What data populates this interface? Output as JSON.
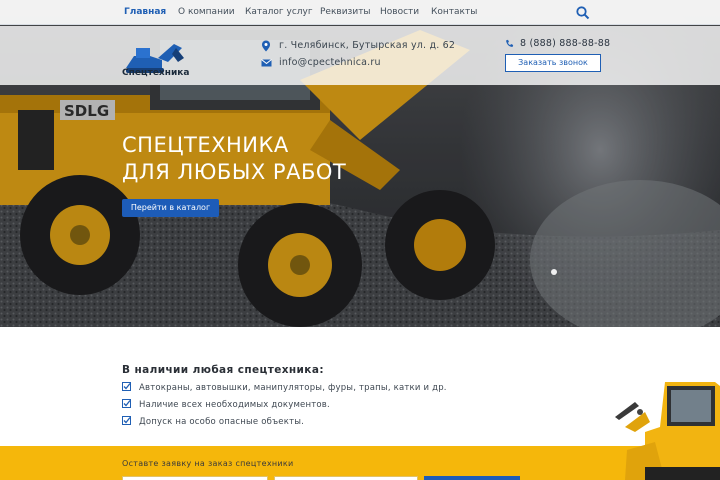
{
  "nav": {
    "items": [
      {
        "label": "Главная",
        "active": true
      },
      {
        "label": "О компании",
        "active": false
      },
      {
        "label": "Каталог услуг",
        "active": false
      },
      {
        "label": "Реквизиты",
        "active": false
      },
      {
        "label": "Новости",
        "active": false
      },
      {
        "label": "Контакты",
        "active": false
      }
    ],
    "search_icon": "search-icon"
  },
  "header": {
    "logo_text": "Спецтехника",
    "address": "г. Челябинск, Бутырская ул. д. 62",
    "email": "info@cpectehnica.ru",
    "phone": "8 (888) 888-88-88",
    "call_button": "Заказать звонок"
  },
  "hero": {
    "title_line1": "СПЕЦТЕХНИКА",
    "title_line2": "ДЛЯ ЛЮБЫХ РАБОТ",
    "cta_label": "Перейти в каталог",
    "loader_brand": "SDLG"
  },
  "availability": {
    "title": "В наличии любая спецтехника:",
    "items": [
      "Автокраны, автовышки, манипуляторы, фуры, трапы, катки и др.",
      "Наличие всех необходимых документов.",
      "Допуск на особо опасные объекты."
    ]
  },
  "form": {
    "label": "Оставте заявку на заказ спецтехники"
  },
  "colors": {
    "accent": "#1d5cb8",
    "yellow": "#f5b70b",
    "nav_active": "#1f5fb4"
  }
}
